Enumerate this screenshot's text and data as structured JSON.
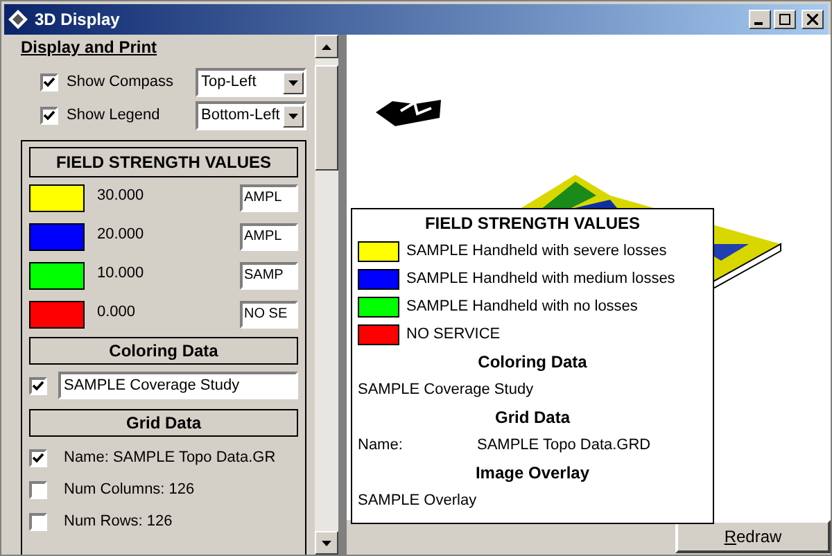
{
  "window": {
    "title": "3D Display"
  },
  "panel": {
    "heading": "Display and Print",
    "options": [
      {
        "label": "Show Compass",
        "checked": true,
        "dropdown": "Top-Left"
      },
      {
        "label": "Show Legend",
        "checked": true,
        "dropdown": "Bottom-Left"
      }
    ],
    "legend_box": {
      "title": "FIELD STRENGTH VALUES",
      "items": [
        {
          "color": "#ffff00",
          "value": "30.000",
          "field": "AMPL"
        },
        {
          "color": "#0000ff",
          "value": "20.000",
          "field": "AMPL"
        },
        {
          "color": "#00ff00",
          "value": "10.000",
          "field": "SAMP"
        },
        {
          "color": "#ff0000",
          "value": "0.000",
          "field": "NO SE"
        }
      ]
    },
    "coloring": {
      "title": "Coloring Data",
      "checked": true,
      "value": "SAMPLE Coverage Study"
    },
    "grid": {
      "title": "Grid Data",
      "items": [
        {
          "label": "Name: SAMPLE Topo Data.GR",
          "checked": true
        },
        {
          "label": "Num Columns: 126",
          "checked": false
        },
        {
          "label": "Num Rows: 126",
          "checked": false
        }
      ]
    }
  },
  "view": {
    "legend": {
      "title": "FIELD STRENGTH VALUES",
      "items": [
        {
          "color": "#ffff00",
          "label": "SAMPLE Handheld with severe losses"
        },
        {
          "color": "#0000ff",
          "label": "SAMPLE Handheld with medium losses"
        },
        {
          "color": "#00ff00",
          "label": "SAMPLE Handheld with no losses"
        },
        {
          "color": "#ff0000",
          "label": "NO SERVICE"
        }
      ],
      "sections": [
        {
          "title": "Coloring Data",
          "rows": [
            {
              "label": "SAMPLE Coverage Study"
            }
          ]
        },
        {
          "title": "Grid Data",
          "rows": [
            {
              "label": "Name:",
              "value": "SAMPLE Topo Data.GRD"
            }
          ]
        },
        {
          "title": "Image Overlay",
          "rows": [
            {
              "label": "SAMPLE Overlay"
            }
          ]
        }
      ]
    }
  },
  "redraw": {
    "label": "Redraw",
    "underline_first": true
  }
}
